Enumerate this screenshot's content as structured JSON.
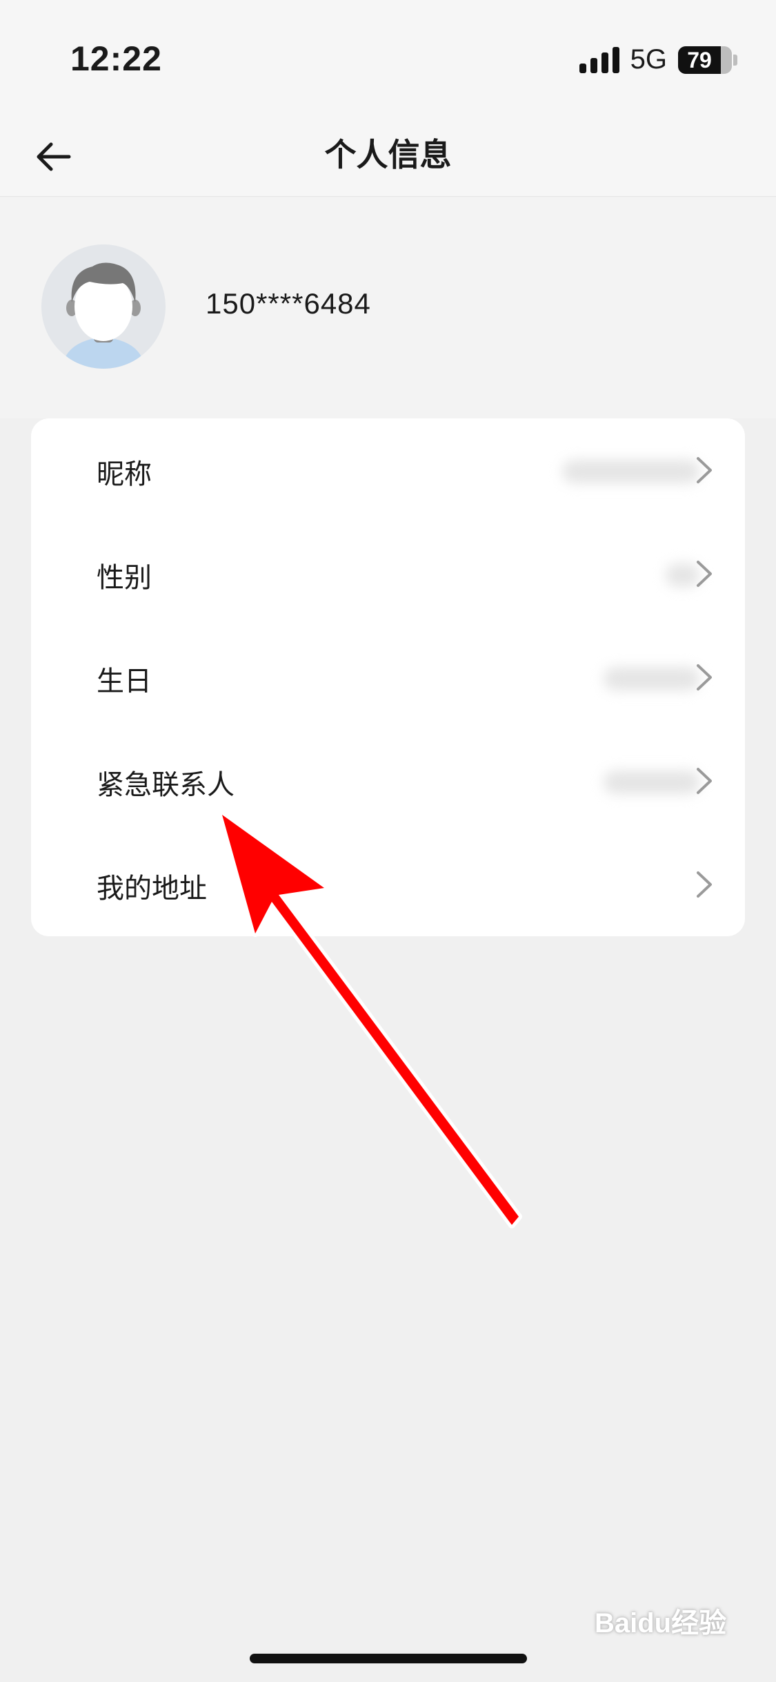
{
  "status_bar": {
    "time": "12:22",
    "network": "5G",
    "battery": "79",
    "battery_level": 0.79
  },
  "header": {
    "title": "个人信息",
    "back_icon": "arrow-left-icon"
  },
  "profile": {
    "avatar_icon": "default-avatar-icon",
    "phone": "150****6484"
  },
  "menu": {
    "items": [
      {
        "label": "昵称",
        "value_blurred": true
      },
      {
        "label": "性别",
        "value_blurred": true
      },
      {
        "label": "生日",
        "value_blurred": true
      },
      {
        "label": "紧急联系人",
        "value_blurred": true
      },
      {
        "label": "我的地址",
        "value_blurred": false
      }
    ],
    "chevron_icon": "chevron-right-icon"
  },
  "annotation": {
    "arrow_icon": "red-pointer-arrow-icon",
    "arrow_color": "#ff0000"
  },
  "watermark": {
    "text": "Baidu经验",
    "icon": "baidu-paw-icon"
  },
  "colors": {
    "background": "#f0f0f0",
    "card": "#ffffff",
    "text": "#1a1a1a",
    "chevron": "#9a9a9a"
  }
}
